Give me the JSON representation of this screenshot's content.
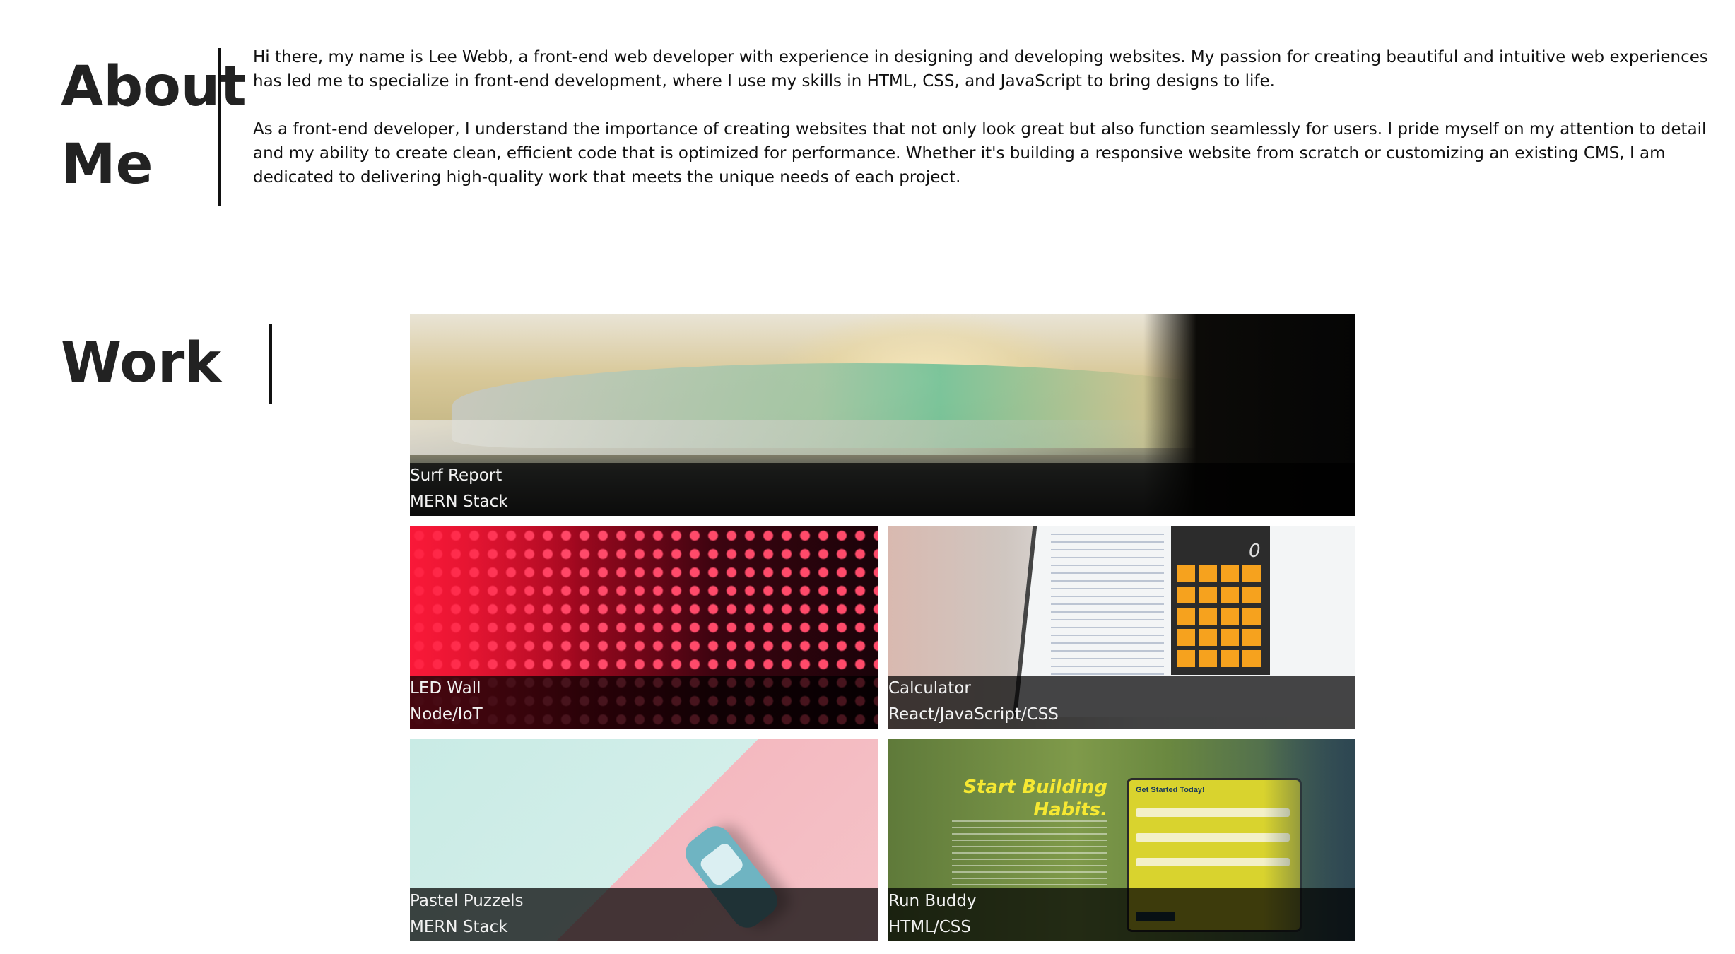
{
  "about": {
    "heading": "About Me",
    "paragraphs": [
      "Hi there, my name is Lee Webb, a front-end web developer with experience in designing and developing websites. My passion for creating beautiful and intuitive web experiences has led me to specialize in front-end development, where I use my skills in HTML, CSS, and JavaScript to bring designs to life.",
      "As a front-end developer, I understand the importance of creating websites that not only look great but also function seamlessly for users. I pride myself on my attention to detail and my ability to create clean, efficient code that is optimized for performance. Whether it's building a responsive website from scratch or customizing an existing CMS, I am dedicated to delivering high-quality work that meets the unique needs of each project."
    ]
  },
  "work": {
    "heading": "Work",
    "projects": [
      {
        "title": "Surf Report",
        "stack": "MERN Stack"
      },
      {
        "title": "LED Wall",
        "stack": "Node/IoT"
      },
      {
        "title": "Calculator",
        "stack": "React/JavaScript/CSS"
      },
      {
        "title": "Pastel Puzzels",
        "stack": "MERN Stack"
      },
      {
        "title": "Run Buddy",
        "stack": "HTML/CSS"
      }
    ],
    "run_buddy_art": {
      "headline": "Start Building Habits.",
      "form_title": "Get Started Today!"
    },
    "calculator_art": {
      "display": "0"
    }
  }
}
